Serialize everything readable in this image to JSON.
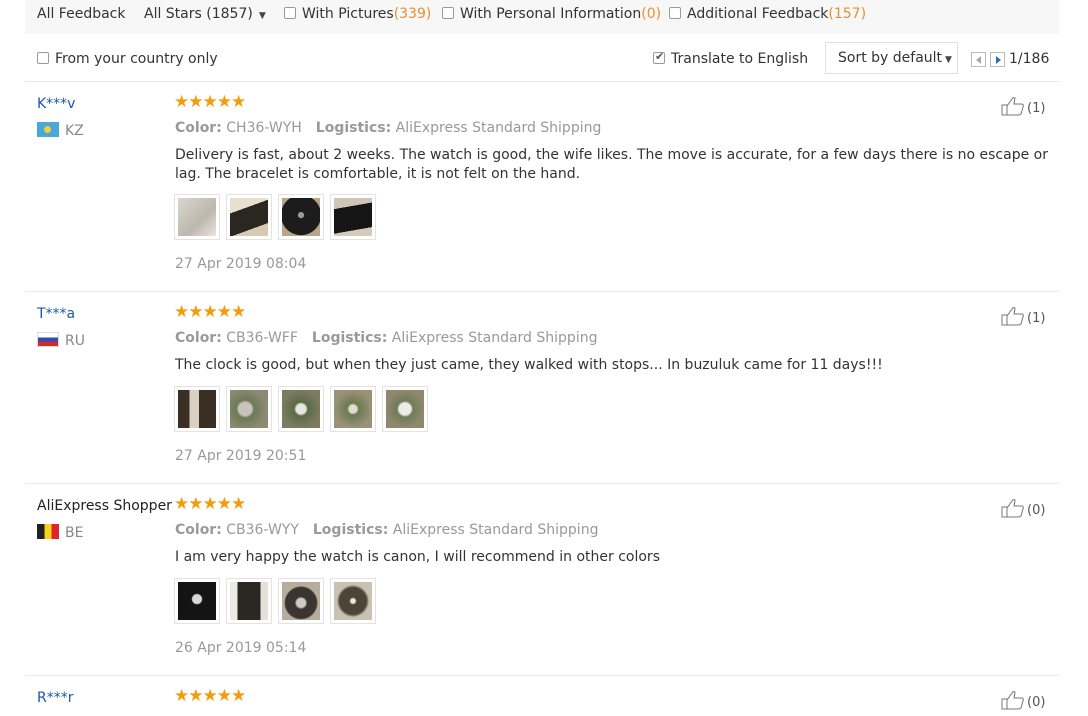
{
  "filters": {
    "all_feedback": "All Feedback",
    "all_stars": "All Stars (1857)",
    "with_pictures_label": "With Pictures",
    "with_pictures_count": "(339)",
    "personal_info_label": "With Personal Information",
    "personal_info_count": "(0)",
    "additional_label": "Additional Feedback",
    "additional_count": "(157)"
  },
  "options": {
    "country_only": "From your country only",
    "translate": "Translate to English",
    "translate_checked": true,
    "sort": "Sort by default",
    "page": "1/186"
  },
  "reviews": [
    {
      "name": "K***v",
      "country": "KZ",
      "stars": "★★★★★",
      "color_label": "Color:",
      "color": "CH36-WYH",
      "logistics_label": "Logistics:",
      "logistics": "AliExpress Standard Shipping",
      "text": "Delivery is fast, about 2 weeks. The watch is good, the wife likes. The move is accurate, for a few days there is no escape or lag. The bracelet is comfortable, it is not felt on the hand.",
      "date": "27 Apr 2019 08:04",
      "helpful": "(1)"
    },
    {
      "name": "T***a",
      "country": "RU",
      "stars": "★★★★★",
      "color_label": "Color:",
      "color": "CB36-WFF",
      "logistics_label": "Logistics:",
      "logistics": "AliExpress Standard Shipping",
      "text": "The clock is good, but when they just came, they walked with stops... In buzuluk came for 11 days!!!",
      "date": "27 Apr 2019 20:51",
      "helpful": "(1)"
    },
    {
      "name": "AliExpress Shopper",
      "country": "BE",
      "stars": "★★★★★",
      "color_label": "Color:",
      "color": "CB36-WYY",
      "logistics_label": "Logistics:",
      "logistics": "AliExpress Standard Shipping",
      "text": "I am very happy the watch is canon, I will recommend in other colors",
      "date": "26 Apr 2019 05:14",
      "helpful": "(0)"
    },
    {
      "name": "R***r",
      "stars": "★★★★★",
      "helpful": "(0)"
    }
  ],
  "colors": {
    "star": "#f59b0c",
    "link": "#1a5aa6",
    "count": "#e8902d"
  }
}
